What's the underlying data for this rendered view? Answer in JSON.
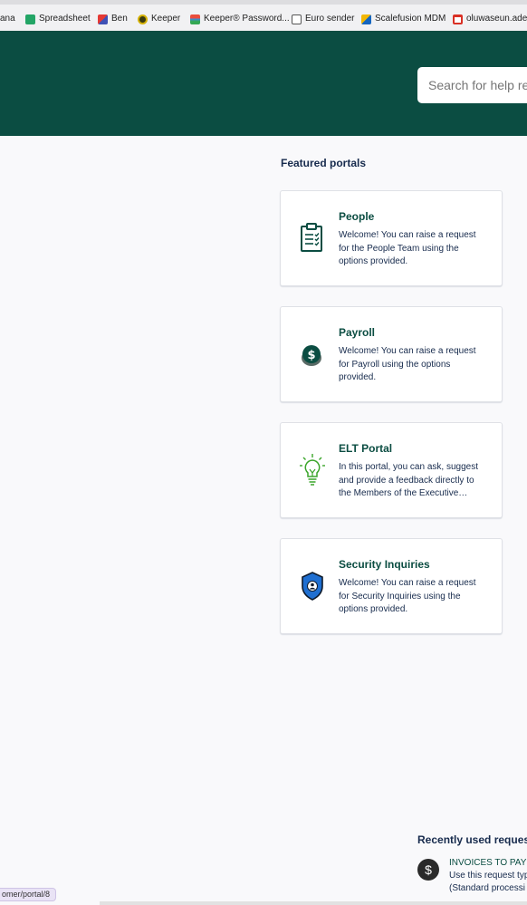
{
  "bookmarks": [
    {
      "label": "ana",
      "color": ""
    },
    {
      "label": "Spreadsheet",
      "color": "#23a566"
    },
    {
      "label": "Ben",
      "color": "#3f51b5"
    },
    {
      "label": "Keeper",
      "color": "#3a3a10"
    },
    {
      "label": "Keeper® Password...",
      "color": "#e94e3c"
    },
    {
      "label": "Euro sender",
      "color": "#555555"
    },
    {
      "label": "Scalefusion MDM",
      "color": "#f2b705"
    },
    {
      "label": "oluwaseun.aded",
      "color": "#d93025"
    }
  ],
  "search": {
    "placeholder": "Search for help res"
  },
  "featured": {
    "title": "Featured portals",
    "portals": [
      {
        "title": "People",
        "description": "Welcome! You can raise a request for the People Team using the options provided.",
        "icon": "clipboard-icon"
      },
      {
        "title": "Payroll",
        "description": "Welcome! You can raise a request for Payroll using the options provided.",
        "icon": "dollar-coin-icon"
      },
      {
        "title": "ELT Portal",
        "description": "In this portal, you can ask, suggest and provide a feedback directly to the Members of the Executive…",
        "icon": "lightbulb-icon"
      },
      {
        "title": "Security Inquiries",
        "description": "Welcome! You can raise a request for Security Inquiries using the options provided.",
        "icon": "shield-icon"
      }
    ]
  },
  "recent": {
    "title": "Recently used request",
    "items": [
      {
        "name": "INVOICES TO PAY",
        "line1": "Use this request typ",
        "line2": "(Standard processi"
      }
    ]
  },
  "status_url": "omer/portal/8",
  "colors": {
    "brand": "#0b4d42",
    "accent_green": "#3aa52a",
    "shield_blue": "#1f6fd1"
  }
}
